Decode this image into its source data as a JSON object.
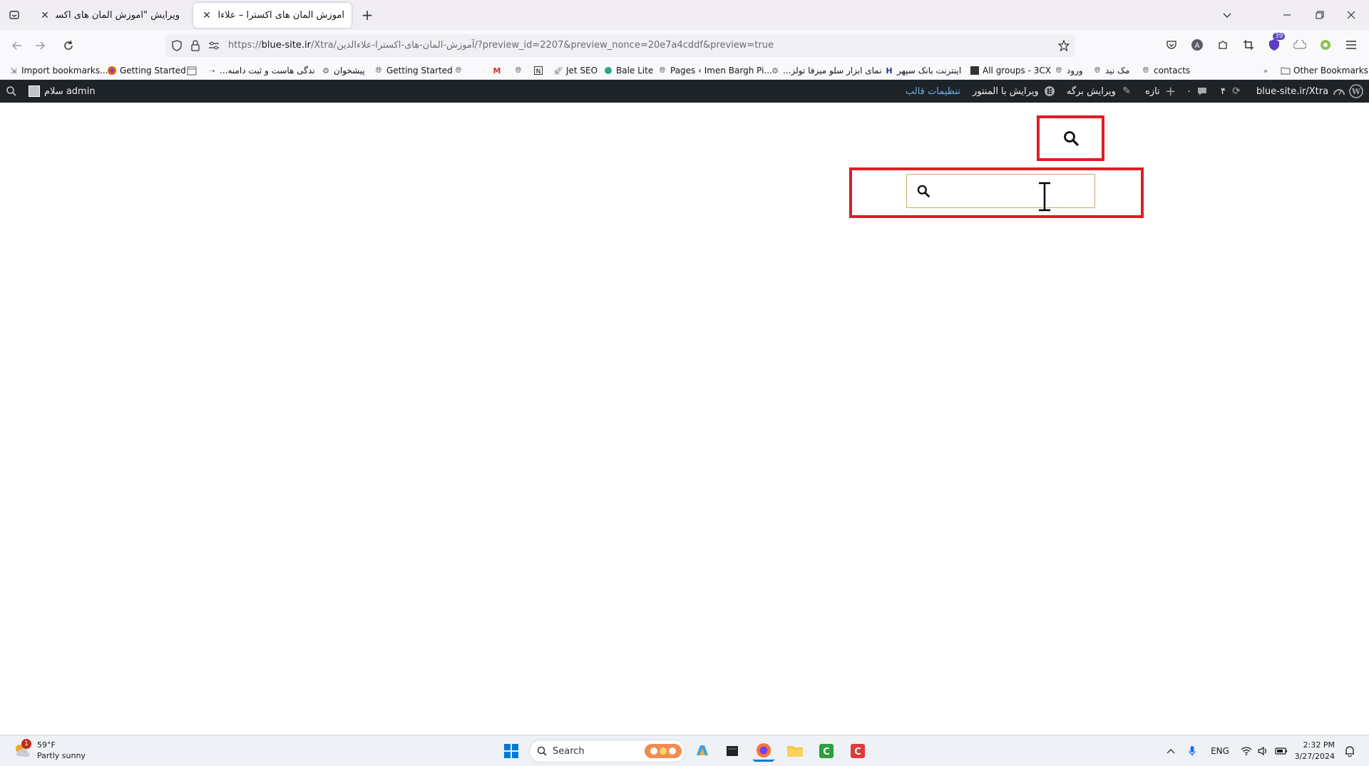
{
  "browser": {
    "tabs": [
      {
        "title": "ویرایش \"آموزش المان های اکسترا – علا",
        "active": false
      },
      {
        "title": "آموزش المان های اکسترا – علاءالدین",
        "active": true
      }
    ],
    "url": {
      "prefix": "https://",
      "host": "blue-site.ir",
      "path": "/Xtra/آموزش-المان-های-اکسترا-علاءالدین/?preview_id=2207&preview_nonce=20e7a4cddf&preview=true"
    },
    "extension_badge": "39",
    "bookmarks": [
      {
        "label": "Import bookmarks...",
        "icon": "import-icon"
      },
      {
        "label": "Getting Started",
        "icon": "firefox-icon"
      },
      {
        "label": "",
        "icon": "calendar-icon"
      },
      {
        "label": "...ندگی هاست و ثبت دامنه",
        "icon": "arrow-icon"
      },
      {
        "label": "پیشخوان",
        "icon": "gear-icon"
      },
      {
        "label": "Getting Started",
        "icon": "globe-icon"
      },
      {
        "label": "",
        "icon": "globe-icon"
      },
      {
        "label": "",
        "icon": "gmail-icon"
      },
      {
        "label": "",
        "icon": "globe-icon"
      },
      {
        "label": "",
        "icon": "notion-icon"
      },
      {
        "label": "Jet SEO",
        "icon": "rocket-icon"
      },
      {
        "label": "Bale Lite",
        "icon": "bale-icon"
      },
      {
        "label": "Pages ‹ Imen Bargh Pi...",
        "icon": "globe-icon"
      },
      {
        "label": "...نمای ابزار سلو میزفا تولز",
        "icon": "gear-icon"
      },
      {
        "label": "اینترنت بانک سپهر",
        "icon": "bank-icon"
      },
      {
        "label": "All groups - 3CX",
        "icon": "3cx-icon"
      },
      {
        "label": "ورود",
        "icon": "globe-icon"
      },
      {
        "label": "مک نید",
        "icon": "globe-icon"
      },
      {
        "label": "contacts",
        "icon": "globe-icon"
      }
    ],
    "other_bookmarks": "Other Bookmarks"
  },
  "wp_admin_bar": {
    "greeting": "سلام admin",
    "theme_settings": "تنظیمات قالب",
    "edit_with_elementor": "ویرایش با المنتور",
    "edit_page": "ویرایش برگه",
    "new": "تازه",
    "comments_count": "۰",
    "updates_count": "۴",
    "site_name": "blue-site.ir/Xtra"
  },
  "page": {
    "search_placeholder": ""
  },
  "taskbar": {
    "weather_temp": "59°F",
    "weather_desc": "Partly sunny",
    "weather_badge": "1",
    "search_label": "Search",
    "language": "ENG",
    "time": "2:32 PM",
    "date": "3/27/2024"
  },
  "colors": {
    "highlight": "#e01b24",
    "wp_bar": "#1d2327",
    "wp_link": "#72aee6",
    "input_border": "#c9a96a"
  }
}
